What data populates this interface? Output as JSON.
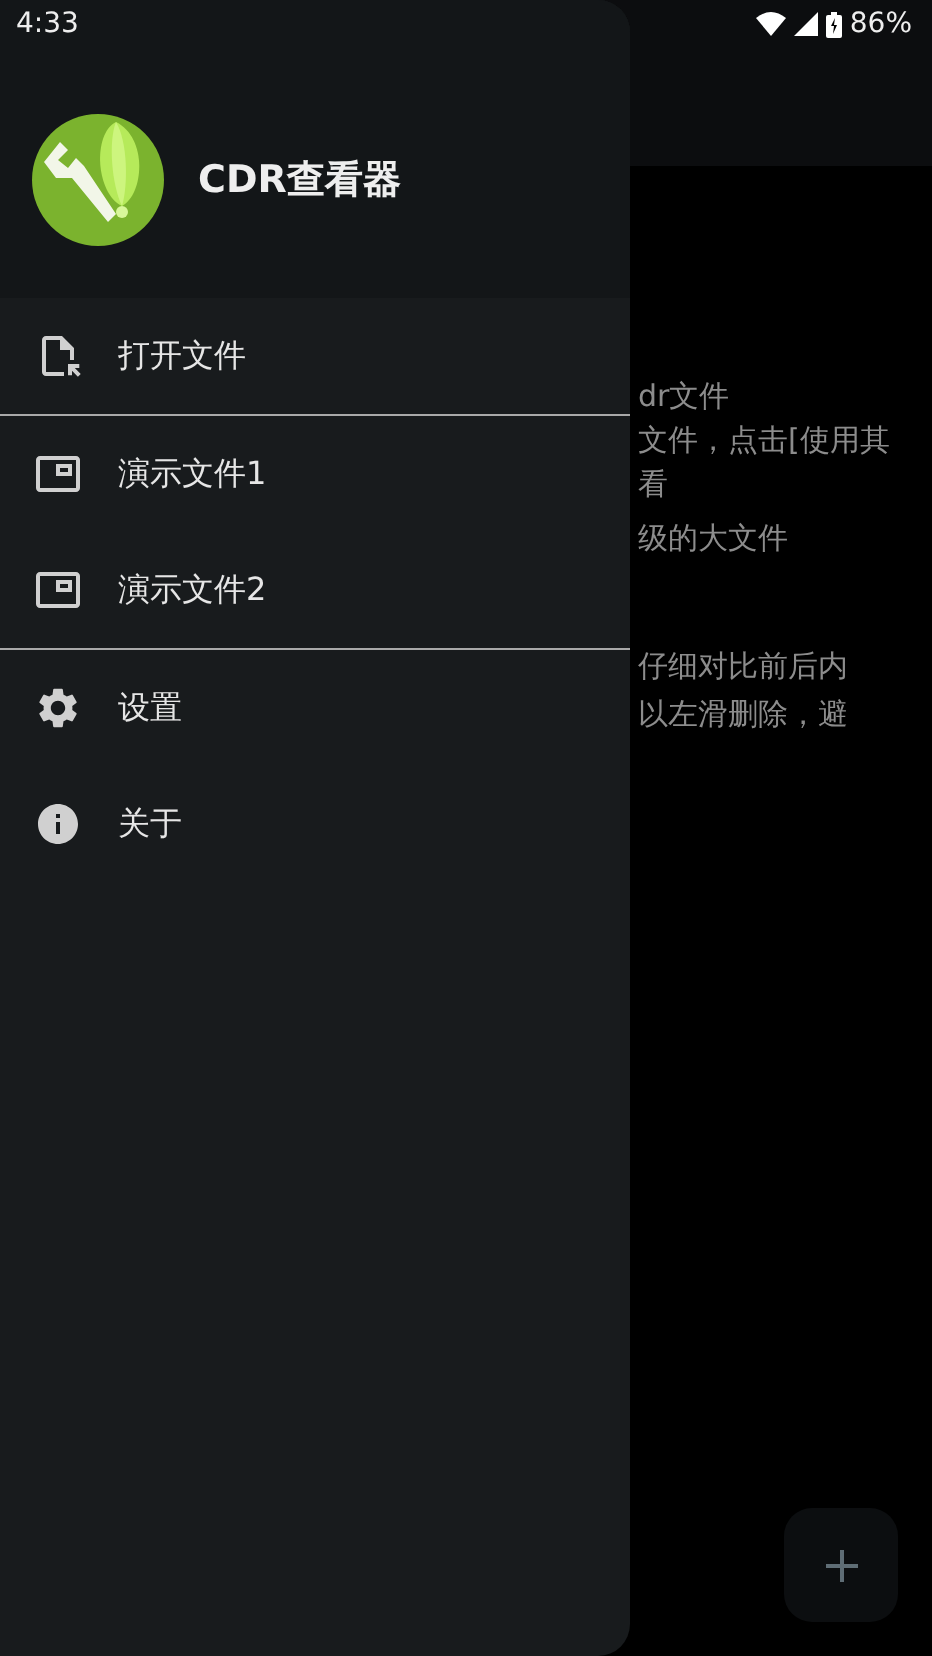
{
  "status_bar": {
    "time": "4:33",
    "battery": "86%"
  },
  "content_lines": [
    "dr文件",
    "文件，点击[使用其",
    "看",
    "级的大文件",
    "仔细对比前后内",
    "以左滑删除，避"
  ],
  "drawer": {
    "title": "CDR查看器",
    "items": [
      {
        "kind": "open",
        "label": "打开文件"
      },
      {
        "kind": "divider"
      },
      {
        "kind": "demo",
        "label": "演示文件1"
      },
      {
        "kind": "demo",
        "label": "演示文件2"
      },
      {
        "kind": "divider"
      },
      {
        "kind": "settings",
        "label": "设置"
      },
      {
        "kind": "about",
        "label": "关于"
      }
    ]
  }
}
